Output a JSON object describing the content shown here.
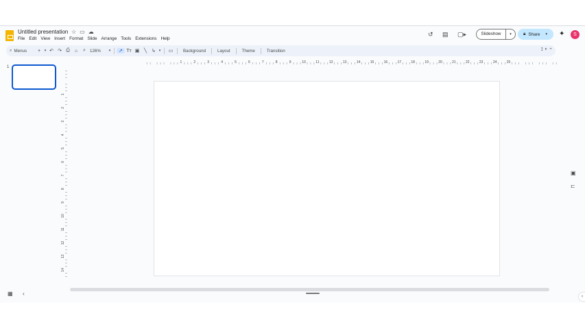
{
  "header": {
    "doc_title": "Untitled presentation",
    "title_icons": [
      "star-icon",
      "move-folder-icon",
      "cloud-status-icon"
    ],
    "menu": [
      "File",
      "Edit",
      "View",
      "Insert",
      "Format",
      "Slide",
      "Arrange",
      "Tools",
      "Extensions",
      "Help"
    ],
    "slideshow_label": "Slideshow",
    "share_label": "Share",
    "avatar_initial": "S"
  },
  "toolbar": {
    "menus_label": "Menus",
    "zoom": "126%",
    "background_label": "Background",
    "layout_label": "Layout",
    "theme_label": "Theme",
    "transition_label": "Transition"
  },
  "filmstrip": {
    "slides": [
      "1"
    ]
  },
  "ruler": {
    "horizontal_labels": [
      "1",
      "2",
      "3",
      "4",
      "5",
      "6",
      "7",
      "8",
      "9",
      "10",
      "11",
      "12",
      "13",
      "14",
      "15",
      "16",
      "17",
      "18",
      "19",
      "20",
      "21",
      "22",
      "23",
      "24",
      "25"
    ],
    "vertical_labels": [
      "1",
      "2",
      "3",
      "4",
      "5",
      "6",
      "7",
      "8",
      "9",
      "10",
      "11",
      "12",
      "13",
      "14"
    ]
  },
  "colors": {
    "accent": "#0b57d0",
    "share_bg": "#c2e7ff",
    "toolbar_bg": "#edf2fa",
    "avatar_bg": "#e8336b",
    "logo": "#f4b400"
  }
}
